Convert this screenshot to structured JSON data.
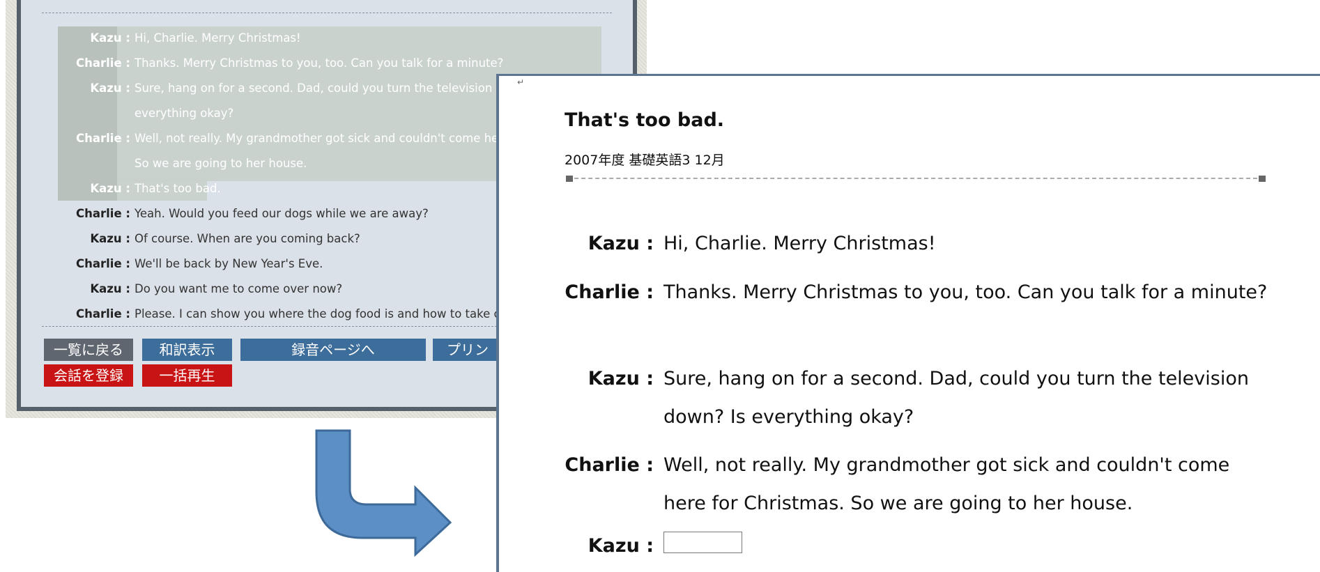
{
  "left": {
    "dialogue": [
      {
        "speaker": "Kazu :",
        "text": "Hi, Charlie. Merry Christmas!"
      },
      {
        "speaker": "Charlie :",
        "text": "Thanks. Merry Christmas to you, too. Can you talk for a minute?"
      },
      {
        "speaker": "Kazu :",
        "text": "Sure, hang on for a second. Dad, could you turn the television d"
      },
      {
        "speaker": "",
        "text": "everything okay?"
      },
      {
        "speaker": "Charlie :",
        "text": "Well, not really. My grandmother got sick and couldn't come he"
      },
      {
        "speaker": "",
        "text": "So we are going to her house."
      },
      {
        "speaker": "Kazu :",
        "text": "That's too bad."
      },
      {
        "speaker": "Charlie :",
        "text": "Yeah. Would you feed our dogs while we are away?"
      },
      {
        "speaker": "Kazu :",
        "text": "Of course. When are you coming back?"
      },
      {
        "speaker": "Charlie :",
        "text": "We'll be back by New Year's Eve."
      },
      {
        "speaker": "Kazu :",
        "text": "Do you want me to come over now?"
      },
      {
        "speaker": "Charlie :",
        "text": "Please. I can show you where the dog food is and how to take c"
      }
    ],
    "buttons": {
      "back": "一覧に戻る",
      "translation": "和訳表示",
      "record": "録音ページへ",
      "print": "プリン",
      "register": "会話を登録",
      "play_all": "一括再生"
    }
  },
  "right": {
    "title": "That's too bad.",
    "subtitle": "2007年度 基礎英語3 12月",
    "dialogue": [
      {
        "speaker": "Kazu :",
        "text": "Hi, Charlie. Merry Christmas!"
      },
      {
        "speaker": "Charlie :",
        "text": "Thanks. Merry Christmas to you, too. Can you talk for a minute?"
      },
      {
        "speaker": "Kazu :",
        "text": "Sure, hang on for a second. Dad, could you turn the television down? Is everything okay?"
      },
      {
        "speaker": "Charlie :",
        "text": "Well, not really. My grandmother got sick and couldn't come here for Christmas. So we are going to her house."
      }
    ],
    "answer_speaker": "Kazu :",
    "answer_value": ""
  },
  "colors": {
    "arrow": "#5b8fc5",
    "arrow_outline": "#3e6a9a",
    "panel_border": "#5e7592"
  }
}
